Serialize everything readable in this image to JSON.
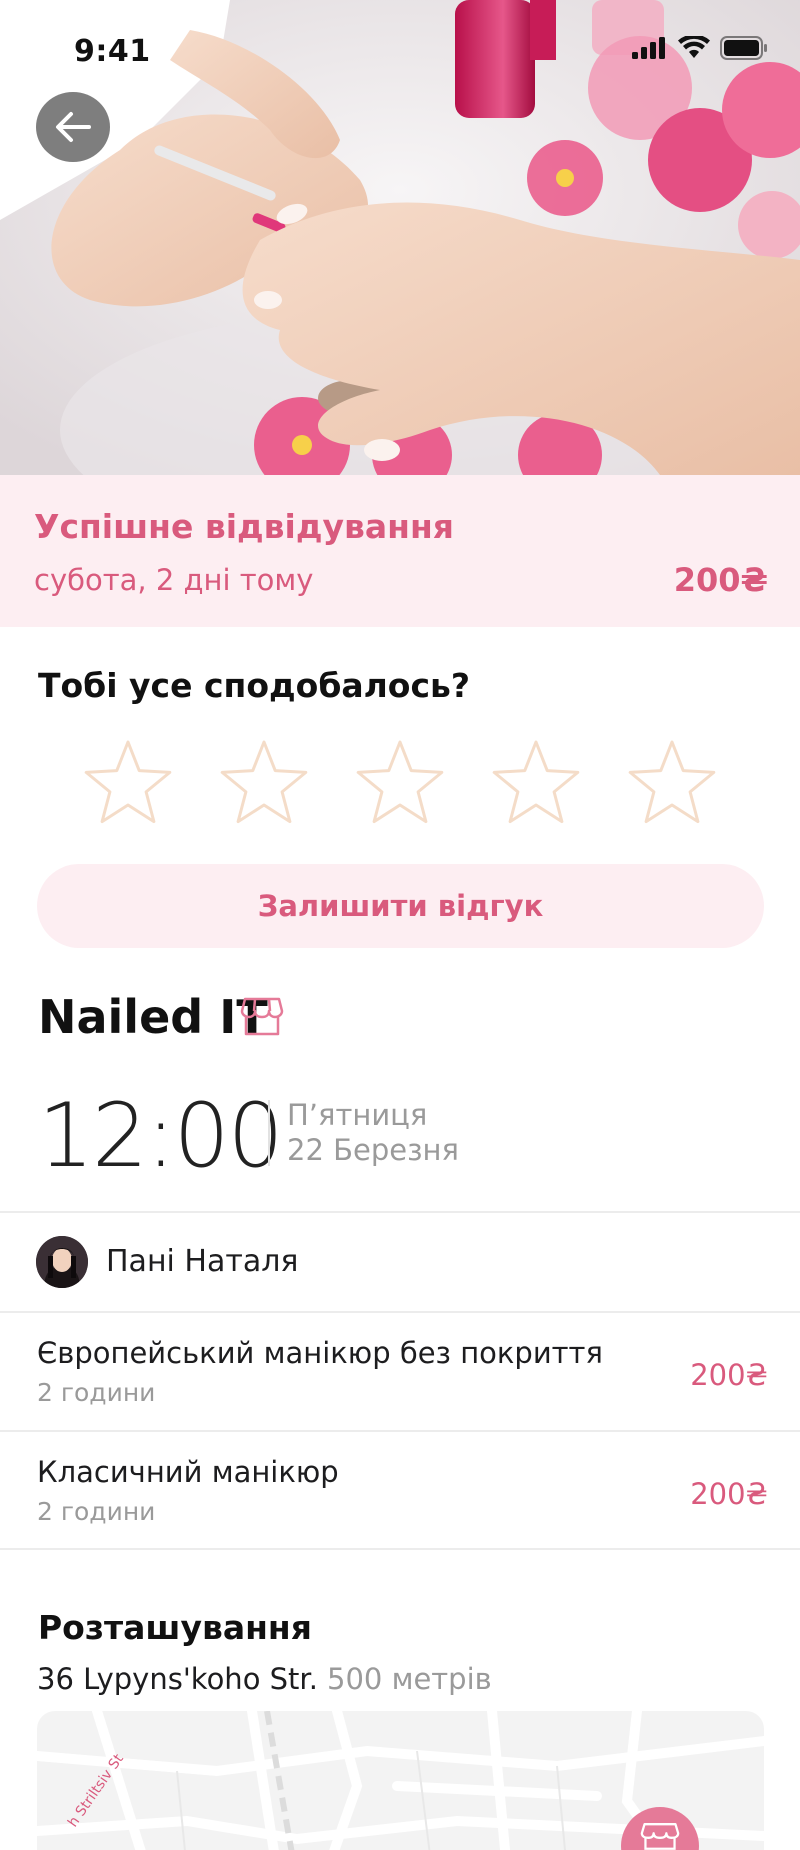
{
  "status_bar": {
    "time": "9:41",
    "icons": [
      "signal-icon",
      "wifi-icon",
      "battery-icon"
    ]
  },
  "hero": {
    "icon": "back-arrow-icon"
  },
  "visit": {
    "title": "Успішне відвідування",
    "date": "субота, 2 дні тому",
    "price": "200₴"
  },
  "rating": {
    "question": "Тобі усе сподобалось?",
    "stars": 5,
    "selected": 0,
    "button_label": "Залишити відгук"
  },
  "salon": {
    "name": "Nailed IT",
    "icon": "storefront-icon"
  },
  "appointment": {
    "time": "12:00",
    "day": "П’ятниця",
    "date": "22 Березня"
  },
  "master": {
    "name": "Пані Наталя"
  },
  "services": [
    {
      "name": "Європейський манікюр без покриття",
      "duration": "2 години",
      "price": "200₴"
    },
    {
      "name": "Класичний манікюр",
      "duration": "2 години",
      "price": "200₴"
    }
  ],
  "location": {
    "title": "Розташування",
    "address": "36 Lypyns'koho Str.",
    "distance": "500 метрів",
    "map_street": "h Striltsiv St"
  },
  "colors": {
    "accent": "#d95a7d",
    "accent_bg": "#fdeef2",
    "star_outline": "#f4dcc8"
  }
}
